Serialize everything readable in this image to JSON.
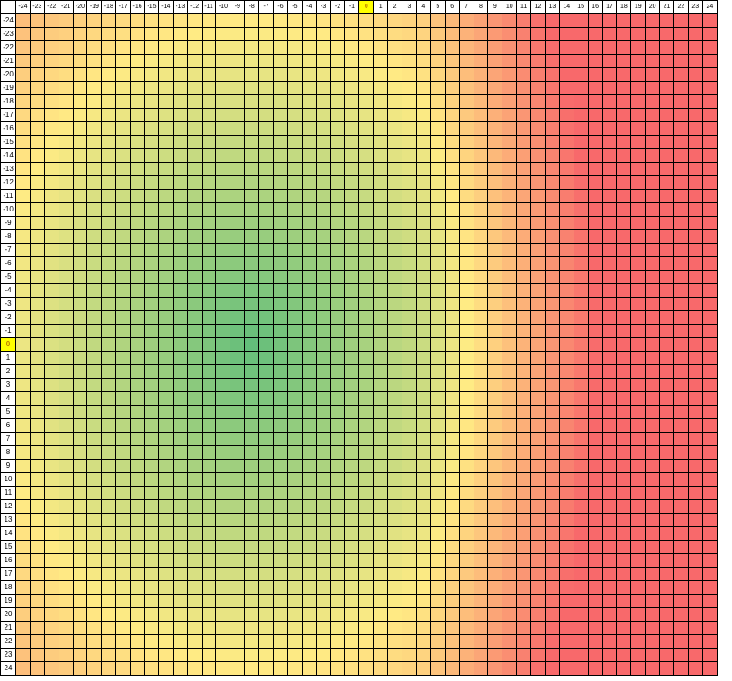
{
  "sheet": {
    "rows": [
      -24,
      -23,
      -22,
      -21,
      -20,
      -19,
      -18,
      -17,
      -16,
      -15,
      -14,
      -13,
      -12,
      -11,
      -10,
      -9,
      -8,
      -7,
      -6,
      -5,
      -4,
      -3,
      -2,
      -1,
      0,
      1,
      2,
      3,
      4,
      5,
      6,
      7,
      8,
      9,
      10,
      11,
      12,
      13,
      14,
      15,
      16,
      17,
      18,
      19,
      20,
      21,
      22,
      23,
      24
    ],
    "columns": [
      -24,
      -23,
      -22,
      -21,
      -20,
      -19,
      -18,
      -17,
      -16,
      -15,
      -14,
      -13,
      -12,
      -11,
      -10,
      -9,
      -8,
      -7,
      -6,
      -5,
      -4,
      -3,
      -2,
      -1,
      0,
      1,
      2,
      3,
      4,
      5,
      6,
      7,
      8,
      9,
      10,
      11,
      12,
      13,
      14,
      15,
      16,
      17,
      18,
      19,
      20,
      21,
      22,
      23,
      24
    ],
    "highlighted_row": 0,
    "highlighted_column": 0,
    "value_unit": "%",
    "colors": {
      "good": "#63be7b",
      "mid": "#ffeb84",
      "bad": "#f8696b",
      "highlight": "#ffff00"
    }
  }
}
